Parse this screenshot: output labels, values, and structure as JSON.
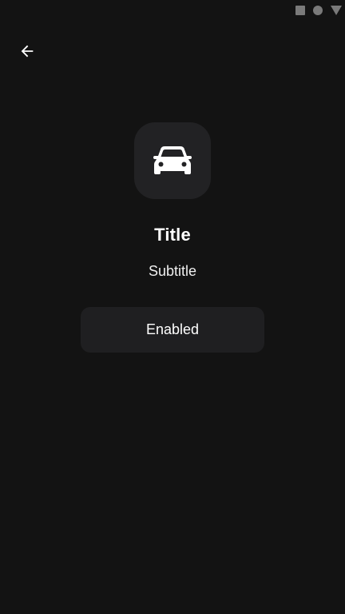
{
  "screen": {
    "title": "Title",
    "subtitle": "Subtitle",
    "button_label": "Enabled",
    "main_icon": "car-icon",
    "back_icon": "arrow-back-icon"
  },
  "status_bar": {
    "icons": [
      "stop-square-icon",
      "circle-icon",
      "triangle-down-icon"
    ]
  },
  "colors": {
    "background": "#131313",
    "tile": "#222224",
    "button": "#1f1f21",
    "text": "#ffffff",
    "status_icons": "#7a7a7a"
  }
}
